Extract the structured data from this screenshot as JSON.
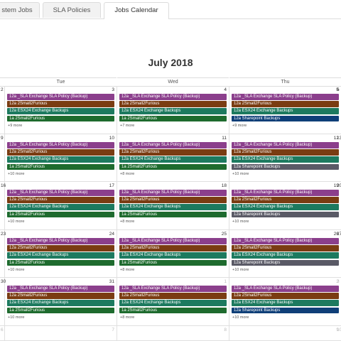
{
  "tabs": [
    {
      "id": "system-jobs",
      "label": "stem Jobs"
    },
    {
      "id": "sla-policies",
      "label": "SLA Policies"
    },
    {
      "id": "jobs-calendar",
      "label": "Jobs Calendar",
      "active": true
    }
  ],
  "calendar": {
    "title": "July 2018",
    "day_headers": [
      "Tue",
      "Wed",
      "Thu"
    ],
    "colors": {
      "sla_exchange": "#8b3f8c",
      "small_furious": "#7a3c12",
      "esx24_exchange": "#1d7a5f",
      "small_furious_1a": "#1e6b2e",
      "sharepoint_blue": "#0f3f78",
      "sharepoint_gray": "#5a5a66"
    },
    "weeks": [
      {
        "edge_left": "2",
        "edge_left_other": false,
        "edge_right": "6",
        "edge_right_other": false,
        "days": [
          {
            "num": "3",
            "events": [
              {
                "label": "12a _SLA Exchange SLA Policy (Backup)",
                "color": "sla_exchange"
              },
              {
                "label": "12a 2Small2Furious",
                "color": "small_furious"
              },
              {
                "label": "12a ESX24 Exchange Backups",
                "color": "esx24_exchange"
              },
              {
                "label": "1a 2Small2Furious",
                "color": "small_furious_1a"
              }
            ],
            "more": "+9 more"
          },
          {
            "num": "4",
            "events": [
              {
                "label": "12a _SLA Exchange SLA Policy (Backup)",
                "color": "sla_exchange"
              },
              {
                "label": "12a 2Small2Furious",
                "color": "small_furious"
              },
              {
                "label": "12a ESX24 Exchange Backups",
                "color": "esx24_exchange"
              },
              {
                "label": "1a 2Small2Furious",
                "color": "small_furious_1a"
              }
            ],
            "more": "+7 more"
          },
          {
            "num": "5",
            "events": [
              {
                "label": "12a _SLA Exchange SLA Policy (Backup)",
                "color": "sla_exchange"
              },
              {
                "label": "12a 2Small2Furious",
                "color": "small_furious"
              },
              {
                "label": "12a ESX24 Exchange Backups",
                "color": "esx24_exchange"
              },
              {
                "label": "12a Sharepoint Backups",
                "color": "sharepoint_blue"
              }
            ],
            "more": "+9 more"
          }
        ]
      },
      {
        "edge_left": "9",
        "edge_left_other": false,
        "edge_right": "13",
        "edge_right_other": false,
        "days": [
          {
            "num": "10",
            "events": [
              {
                "label": "12a _SLA Exchange SLA Policy (Backup)",
                "color": "sla_exchange"
              },
              {
                "label": "12a 2Small2Furious",
                "color": "small_furious"
              },
              {
                "label": "12a ESX24 Exchange Backups",
                "color": "esx24_exchange"
              },
              {
                "label": "1a 2Small2Furious",
                "color": "small_furious_1a"
              }
            ],
            "more": "+10 more"
          },
          {
            "num": "11",
            "events": [
              {
                "label": "12a _SLA Exchange SLA Policy (Backup)",
                "color": "sla_exchange"
              },
              {
                "label": "12a 2Small2Furious",
                "color": "small_furious"
              },
              {
                "label": "12a ESX24 Exchange Backups",
                "color": "esx24_exchange"
              },
              {
                "label": "1a 2Small2Furious",
                "color": "small_furious_1a"
              }
            ],
            "more": "+8 more"
          },
          {
            "num": "12",
            "events": [
              {
                "label": "12a _SLA Exchange SLA Policy (Backup)",
                "color": "sla_exchange"
              },
              {
                "label": "12a 2Small2Furious",
                "color": "small_furious"
              },
              {
                "label": "12a ESX24 Exchange Backups",
                "color": "esx24_exchange"
              },
              {
                "label": "12a Sharepoint Backups",
                "color": "sharepoint_gray"
              }
            ],
            "more": "+10 more"
          }
        ]
      },
      {
        "edge_left": "16",
        "edge_left_other": false,
        "edge_right": "20",
        "edge_right_other": false,
        "days": [
          {
            "num": "17",
            "events": [
              {
                "label": "12a _SLA Exchange SLA Policy (Backup)",
                "color": "sla_exchange"
              },
              {
                "label": "12a 2Small2Furious",
                "color": "small_furious"
              },
              {
                "label": "12a ESX24 Exchange Backups",
                "color": "esx24_exchange"
              },
              {
                "label": "1a 2Small2Furious",
                "color": "small_furious_1a"
              }
            ],
            "more": "+10 more"
          },
          {
            "num": "18",
            "events": [
              {
                "label": "12a _SLA Exchange SLA Policy (Backup)",
                "color": "sla_exchange"
              },
              {
                "label": "12a 2Small2Furious",
                "color": "small_furious"
              },
              {
                "label": "12a ESX24 Exchange Backups",
                "color": "esx24_exchange"
              },
              {
                "label": "1a 2Small2Furious",
                "color": "small_furious_1a"
              }
            ],
            "more": "+8 more"
          },
          {
            "num": "19",
            "events": [
              {
                "label": "12a _SLA Exchange SLA Policy (Backup)",
                "color": "sla_exchange"
              },
              {
                "label": "12a 2Small2Furious",
                "color": "small_furious"
              },
              {
                "label": "12a ESX24 Exchange Backups",
                "color": "esx24_exchange"
              },
              {
                "label": "12a Sharepoint Backups",
                "color": "sharepoint_gray"
              }
            ],
            "more": "+10 more"
          }
        ]
      },
      {
        "edge_left": "23",
        "edge_left_other": false,
        "edge_right": "27",
        "edge_right_other": false,
        "days": [
          {
            "num": "24",
            "events": [
              {
                "label": "12a _SLA Exchange SLA Policy (Backup)",
                "color": "sla_exchange"
              },
              {
                "label": "12a 2Small2Furious",
                "color": "small_furious"
              },
              {
                "label": "12a ESX24 Exchange Backups",
                "color": "esx24_exchange"
              },
              {
                "label": "1a 2Small2Furious",
                "color": "small_furious_1a"
              }
            ],
            "more": "+10 more"
          },
          {
            "num": "25",
            "events": [
              {
                "label": "12a _SLA Exchange SLA Policy (Backup)",
                "color": "sla_exchange"
              },
              {
                "label": "12a 2Small2Furious",
                "color": "small_furious"
              },
              {
                "label": "12a ESX24 Exchange Backups",
                "color": "esx24_exchange"
              },
              {
                "label": "1a 2Small2Furious",
                "color": "small_furious_1a"
              }
            ],
            "more": "+8 more"
          },
          {
            "num": "26",
            "events": [
              {
                "label": "12a _SLA Exchange SLA Policy (Backup)",
                "color": "sla_exchange"
              },
              {
                "label": "12a 2Small2Furious",
                "color": "small_furious"
              },
              {
                "label": "12a ESX24 Exchange Backups",
                "color": "esx24_exchange"
              },
              {
                "label": "12a Sharepoint Backups",
                "color": "sharepoint_gray"
              }
            ],
            "more": "+10 more"
          }
        ]
      },
      {
        "edge_left": "30",
        "edge_left_other": false,
        "edge_right": "3",
        "edge_right_other": true,
        "days": [
          {
            "num": "31",
            "events": [
              {
                "label": "12a _SLA Exchange SLA Policy (Backup)",
                "color": "sla_exchange"
              },
              {
                "label": "12a 2Small2Furious",
                "color": "small_furious"
              },
              {
                "label": "12a ESX24 Exchange Backups",
                "color": "esx24_exchange"
              },
              {
                "label": "1a 2Small2Furious",
                "color": "small_furious_1a"
              }
            ],
            "more": "+10 more"
          },
          {
            "num": "1",
            "other": true,
            "events": [
              {
                "label": "12a _SLA Exchange SLA Policy (Backup)",
                "color": "sla_exchange"
              },
              {
                "label": "12a 2Small2Furious",
                "color": "small_furious"
              },
              {
                "label": "12a ESX24 Exchange Backups",
                "color": "esx24_exchange"
              },
              {
                "label": "1a 2Small2Furious",
                "color": "small_furious_1a"
              }
            ],
            "more": "+8 more"
          },
          {
            "num": "2",
            "other": true,
            "events": [
              {
                "label": "12a _SLA Exchange SLA Policy (Backup)",
                "color": "sla_exchange"
              },
              {
                "label": "12a 2Small2Furious",
                "color": "small_furious"
              },
              {
                "label": "12a ESX24 Exchange Backups",
                "color": "esx24_exchange"
              },
              {
                "label": "12a Sharepoint Backups",
                "color": "sharepoint_blue"
              }
            ],
            "more": "+10 more"
          }
        ]
      },
      {
        "edge_left": "6",
        "edge_left_other": true,
        "edge_right": "10",
        "edge_right_other": true,
        "days": [
          {
            "num": "7",
            "other": true,
            "events": [],
            "more": ""
          },
          {
            "num": "8",
            "other": true,
            "events": [],
            "more": ""
          },
          {
            "num": "9",
            "other": true,
            "events": [],
            "more": ""
          }
        ]
      }
    ]
  }
}
